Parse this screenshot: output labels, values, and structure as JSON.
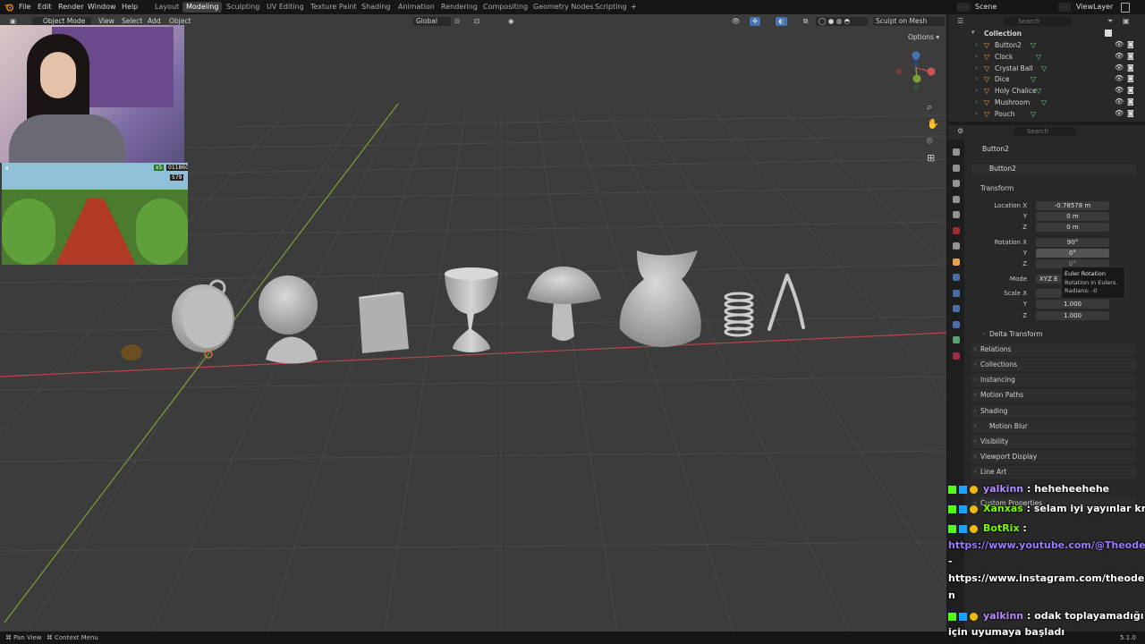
{
  "topbar": {
    "menus": [
      "File",
      "Edit",
      "Render",
      "Window",
      "Help"
    ],
    "workspaces": [
      "Layout",
      "Modeling",
      "Sculpting",
      "UV Editing",
      "Texture Paint",
      "Shading",
      "Animation",
      "Rendering",
      "Compositing",
      "Geometry Nodes",
      "Scripting"
    ],
    "active_workspace": "Modeling",
    "add_workspace": "+",
    "scene": "Scene",
    "view_layer": "ViewLayer"
  },
  "viewport_header": {
    "mode": "Object Mode",
    "menus": [
      "View",
      "Select",
      "Add",
      "Object"
    ],
    "orientation": "Global",
    "sculpt_button": "Sculpt on Mesh",
    "options": "Options"
  },
  "outliner": {
    "search_placeholder": "Search",
    "collection": "Collection",
    "items": [
      "Button2",
      "Clock",
      "Crystal Ball",
      "Dice",
      "Holy Chalice",
      "Mushroom",
      "Pouch"
    ]
  },
  "properties": {
    "search_placeholder": "Search",
    "object_name": "Button2",
    "datablock": "Button2",
    "transform_title": "Transform",
    "location": {
      "label_x": "Location X",
      "label_y": "Y",
      "label_z": "Z",
      "x": "-0.78578 m",
      "y": "0 m",
      "z": "0 m"
    },
    "rotation": {
      "label_x": "Rotation X",
      "label_y": "Y",
      "label_z": "Z",
      "x": "90°",
      "y": "0°",
      "z": "0°"
    },
    "mode": {
      "label": "Mode",
      "value": "XYZ E"
    },
    "scale": {
      "label_x": "Scale X",
      "label_y": "Y",
      "label_z": "Z",
      "y": "1.000",
      "z": "1.000"
    },
    "tooltip": {
      "title": "Euler Rotation",
      "desc": "Rotation in Eulers.",
      "radians": "Radians: -0"
    },
    "panels": [
      "Delta Transform",
      "Relations",
      "Collections",
      "Instancing",
      "Motion Paths",
      "Shading",
      "Motion Blur",
      "Visibility",
      "Viewport Display",
      "Line Art",
      "Custom Properties"
    ]
  },
  "statusbar": {
    "left1": "Pan View",
    "left2": "Context Menu",
    "version": "5.1.0"
  },
  "game_overlay": {
    "multiplier": "x5",
    "score": "011860",
    "coins": "579"
  },
  "chat": [
    {
      "user": "yalkinn",
      "user_color": "#b48cff",
      "message": ": heheheehehe"
    },
    {
      "user": "Xanxas",
      "user_color": "#7cfc00",
      "message": ": selam iyi yayınlar kral"
    },
    {
      "user": "BotRix",
      "user_color": "#7cfc00",
      "message": ":"
    },
    {
      "user": "",
      "user_color": "",
      "message": "https://www.youtube.com/@Theoderin"
    },
    {
      "user": "",
      "user_color": "",
      "message": "-"
    },
    {
      "user": "",
      "user_color": "",
      "message": "https://www.instagram.com/theoderin"
    },
    {
      "user": "",
      "user_color": "",
      "message": "n"
    },
    {
      "user": "yalkinn",
      "user_color": "#b48cff",
      "message": ": odak toplayamadığı"
    },
    {
      "user": "",
      "user_color": "",
      "message": "için uyumaya başladı"
    }
  ],
  "colors": {
    "accent": "#4772b3",
    "x_axis": "#b5464b",
    "y_axis": "#7c9f35",
    "viewport_bg": "#3c3c3c",
    "link": "#9b7bff"
  }
}
